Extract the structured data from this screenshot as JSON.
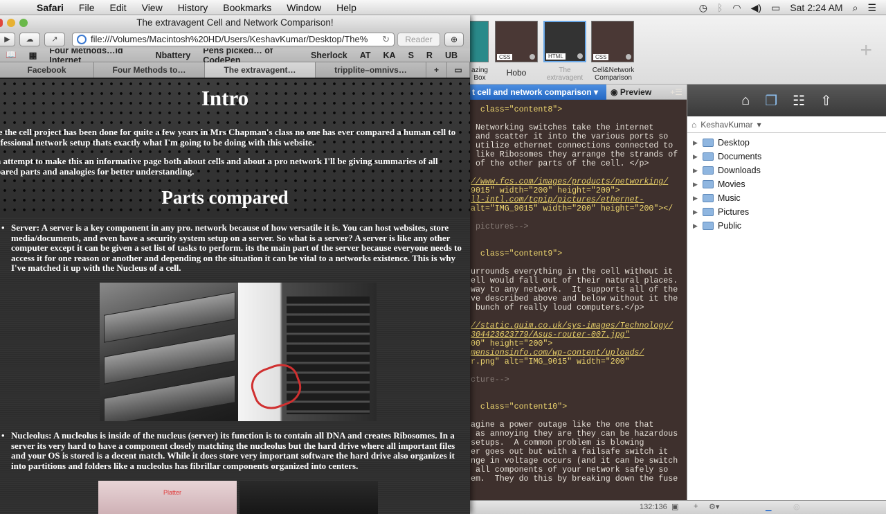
{
  "menubar": {
    "app": "Safari",
    "items": [
      "File",
      "Edit",
      "View",
      "History",
      "Bookmarks",
      "Window",
      "Help"
    ],
    "clock": "Sat 2:24 AM"
  },
  "safari": {
    "title": "The extravagent Cell and Network Comparison!",
    "url": "file:///Volumes/Macintosh%20HD/Users/KeshavKumar/Desktop/The%",
    "reader": "Reader",
    "bookmarks": [
      "Four Methods…ld Internet",
      "Nbattery",
      "Pens picked… of CodePen",
      "Sherlock",
      "AT",
      "KA",
      "S",
      "R",
      "UB"
    ],
    "tabs": [
      "Facebook",
      "Four Methods to…",
      "The extravagent…",
      "tripplite–omnivs…"
    ]
  },
  "page": {
    "h_intro": "Intro",
    "intro_p1_line1": "le the cell project has been done for quite a few years in Mrs Chapman's class no one has ever compared a human cell to",
    "intro_p1_line2": "ofessional network setup thats exactly what I'm going to be doing with this website.",
    "intro_p2_line1": "n attempt to make this an informative page both about cells and about a pro network I'll be giving summaries of all",
    "intro_p2_line2": "pared parts and analogies for better understanding.",
    "h_parts": "Parts compared",
    "server_text": "Server: A server is a key component in any pro. network because of how versatile it is. You can host websites, store media/documents, and even have a security system setup on a server. So what is a server? A server is like any other computer except it can be given a set list of tasks to perform. its the main part of the server because everyone needs to access it for one reason or another and depending on the situation it can be vital to a networks existence. This is why I've matched it up with the Nucleus of a cell.",
    "nucleolus_text": "Nucleolus: A nucleolus is inside of the nucleus (server) its function is to contain all DNA and creates Ribosomes. In a server its very hard to have a component closely matching the nucleolus but the hard drive where all important files and your OS is stored is a decent match. While it does store very important software the hard drive also organizes it into partitions and folders like a nucleolus has fibrillar components organized into centers.",
    "photo_label": "Platter"
  },
  "editor": {
    "file_tabs": [
      {
        "type": "",
        "caption": "azing\nBox"
      },
      {
        "type": "CSS",
        "caption": "Hobo"
      },
      {
        "type": "HTML",
        "caption": "The\nextravagent"
      },
      {
        "type": "CSS",
        "caption": "Cell&Network\nComparison"
      }
    ],
    "crumb": "t cell and network comparison ▾",
    "preview": "Preview",
    "code_lines": [
      {
        "t": "  class=\"content8\">",
        "k": "a"
      },
      {
        "t": "",
        "k": ""
      },
      {
        "t": " Networking switches take the internet",
        "k": ""
      },
      {
        "t": " and scatter it into the various ports so",
        "k": ""
      },
      {
        "t": " utilize ethernet connections connected to",
        "k": ""
      },
      {
        "t": " like Ribosomes they arrange the strands of",
        "k": ""
      },
      {
        "t": " of the other parts of the cell. </p>",
        "k": ""
      },
      {
        "t": "",
        "k": ""
      },
      {
        "t": "//www.fcs.com/images/products/networking/",
        "k": "u"
      },
      {
        "t": "9015\" width=\"200\" height=\"200\">",
        "k": "a"
      },
      {
        "t": "ll-intl.com/tcpip/pictures/ethernet-",
        "k": "u"
      },
      {
        "t": "alt=\"IMG_9015\" width=\"200\" height=\"200\"></",
        "k": "a"
      },
      {
        "t": "",
        "k": ""
      },
      {
        "t": " pictures-->",
        "k": "c"
      },
      {
        "t": "",
        "k": ""
      },
      {
        "t": "",
        "k": ""
      },
      {
        "t": "  class=\"content9\">",
        "k": "a"
      },
      {
        "t": "",
        "k": ""
      },
      {
        "t": "urrounds everything in the cell without it",
        "k": ""
      },
      {
        "t": "ell would fall out of their natural places.",
        "k": ""
      },
      {
        "t": "way to any network.  It supports all of the",
        "k": ""
      },
      {
        "t": "ve described above and below without it the",
        "k": ""
      },
      {
        "t": " bunch of really loud computers.</p>",
        "k": ""
      },
      {
        "t": "",
        "k": ""
      },
      {
        "t": "//static.guim.co.uk/sys-images/Technology/",
        "k": "u"
      },
      {
        "t": "304423623779/Asus-router-007.jpg\"",
        "k": "u"
      },
      {
        "t": "00\" height=\"200\">",
        "k": "a"
      },
      {
        "t": "mensionsinfo.com/wp-content/uploads/",
        "k": "u"
      },
      {
        "t": "r.png\" alt=\"IMG_9015\" width=\"200\"",
        "k": "a"
      },
      {
        "t": "",
        "k": ""
      },
      {
        "t": "cture-->",
        "k": "c"
      },
      {
        "t": "",
        "k": ""
      },
      {
        "t": "",
        "k": ""
      },
      {
        "t": "  class=\"content10\">",
        "k": "a"
      },
      {
        "t": "",
        "k": ""
      },
      {
        "t": "agine a power outage like the one that",
        "k": ""
      },
      {
        "t": " as annoying they are they can be hazardous",
        "k": ""
      },
      {
        "t": "setups.  A common problem is blowing",
        "k": ""
      },
      {
        "t": "er goes out but with a failsafe switch it",
        "k": ""
      },
      {
        "t": "nge in voltage occurs (and it can be switch",
        "k": ""
      },
      {
        "t": " all components of your network safely so",
        "k": ""
      },
      {
        "t": "em.  They do this by breaking down the fuse",
        "k": ""
      }
    ],
    "path_user": "KeshavKumar",
    "folders": [
      "Desktop",
      "Documents",
      "Downloads",
      "Movies",
      "Music",
      "Pictures",
      "Public"
    ],
    "cursor_pos": "132:136"
  }
}
